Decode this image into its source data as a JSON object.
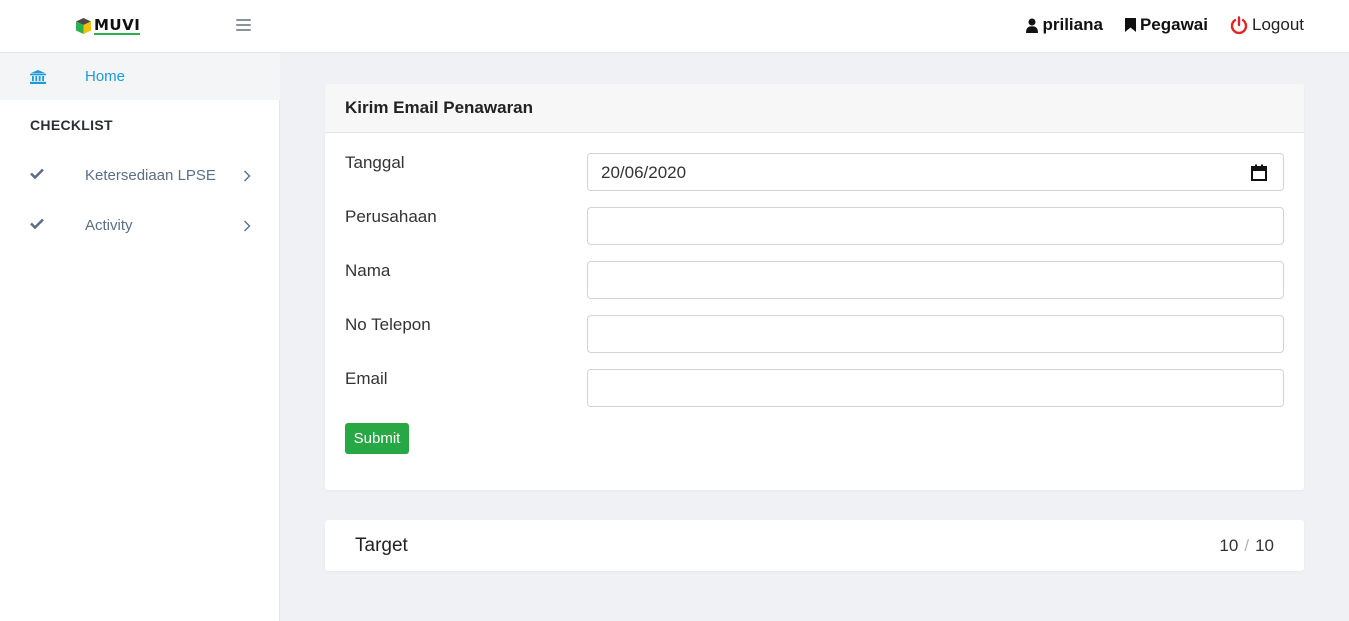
{
  "header": {
    "logo_text": "MUVI",
    "user_name": "priliana",
    "role": "Pegawai",
    "logout_label": "Logout"
  },
  "sidebar": {
    "home_label": "Home",
    "section_title": "CHECKLIST",
    "items": [
      {
        "label": "Ketersediaan LPSE",
        "icon": "check-icon"
      },
      {
        "label": "Activity",
        "icon": "check-icon"
      }
    ]
  },
  "form_card": {
    "title": "Kirim Email Penawaran",
    "fields": [
      {
        "label": "Tanggal",
        "value": "20/06/2020",
        "type": "date"
      },
      {
        "label": "Perusahaan",
        "value": "",
        "type": "text"
      },
      {
        "label": "Nama",
        "value": "",
        "type": "text"
      },
      {
        "label": "No Telepon",
        "value": "",
        "type": "text"
      },
      {
        "label": "Email",
        "value": "",
        "type": "text"
      }
    ],
    "submit_label": "Submit"
  },
  "target_card": {
    "label": "Target",
    "current": "10",
    "separator": "/",
    "total": "10"
  },
  "colors": {
    "accent": "#1b9cd8",
    "submit": "#28a745",
    "logout_icon": "#e02424",
    "background": "#f0f1f5"
  }
}
